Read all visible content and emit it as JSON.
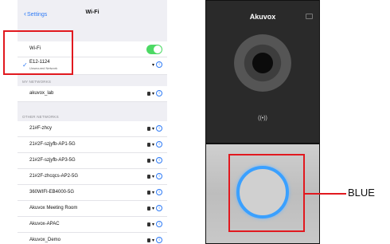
{
  "settings": {
    "back_label": "Settings",
    "title": "Wi-Fi",
    "wifi_label": "Wi-Fi",
    "wifi_enabled": true,
    "current": {
      "name": "E12-1124",
      "status": "Unsecured Network"
    },
    "my_networks_header": "MY NETWORKS",
    "my_networks": [
      "akuvox_lab"
    ],
    "other_networks_header": "OTHER NETWORKS",
    "other_networks": [
      "21#F-zhcy",
      "21#2F-szjyfb-AP1-5G",
      "21#2F-szjyfb-AP3-5G",
      "21#2F-zhcqcs-AP2-5G",
      "360WIFI-EB4000-5G",
      "Akuvox Meeting Room",
      "Akuvox-APAC",
      "Akuvox_Demo"
    ]
  },
  "device": {
    "brand": "Akuvox",
    "nfc_symbol": "((•))",
    "callout_label": "BLUE",
    "button_color": "#3aa0ff",
    "highlight_color": "#e1191f"
  }
}
